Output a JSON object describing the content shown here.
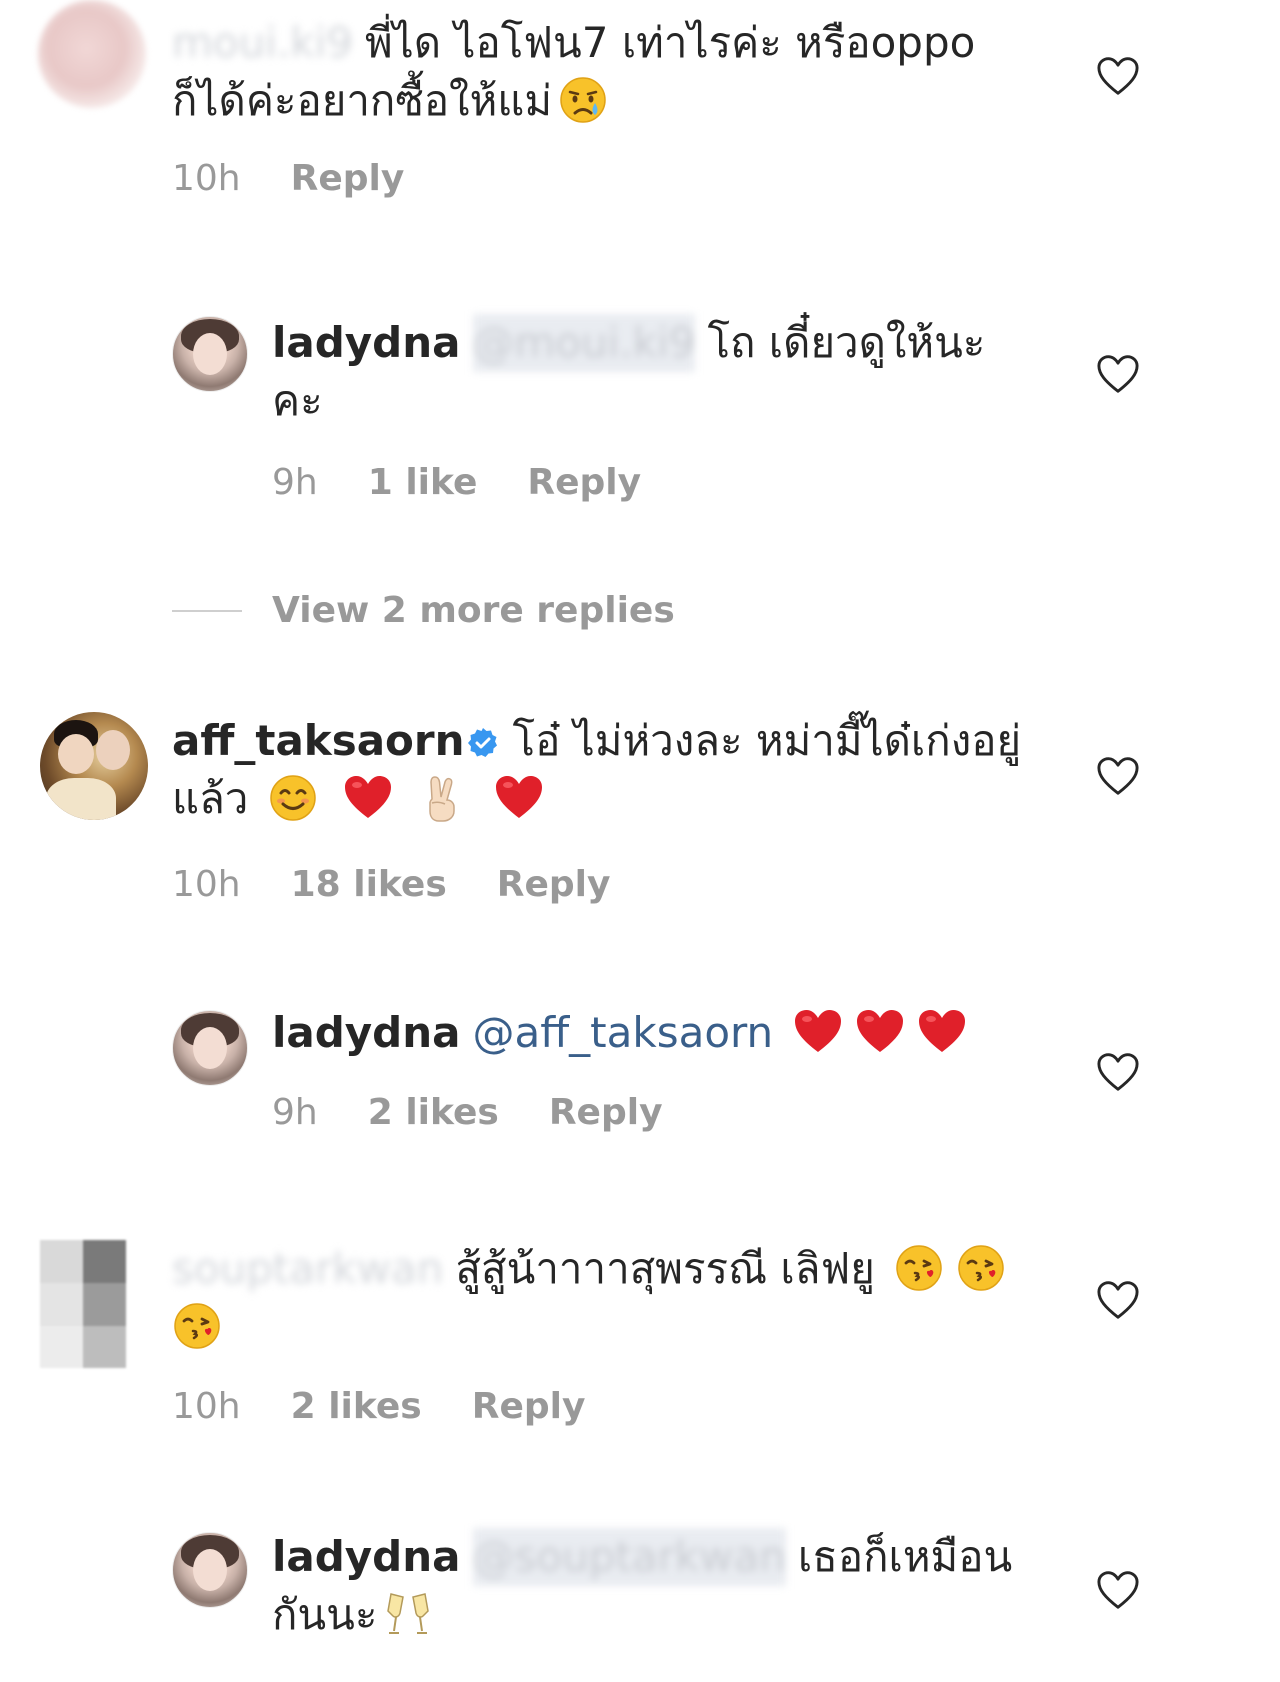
{
  "comments": [
    {
      "blurred_user": "moui.ki9",
      "text_line1": "พี่ได ไอโฟน7 เท่าไรค่ะ หรือoppo",
      "text_line2": "ก็ได้ค่ะอยากซื้อให้แม่",
      "emoji_end": "crying-face",
      "time": "10h",
      "reply": "Reply"
    },
    {
      "user": "ladydna",
      "blurred_mention": "@moui.ki9",
      "text_line1": "โถ เดี๋ยวดูให้นะ",
      "text_line2": "คะ",
      "time": "9h",
      "likes": "1 like",
      "reply": "Reply"
    },
    {
      "more_replies": "View 2 more replies"
    },
    {
      "user": "aff_taksaorn",
      "text_line1": "โอ๋ ไม่ห่วงละ หม่ามี๊ได๋เก่งอยู่",
      "text_line2": "แล้ว",
      "emojis": [
        "smiling-face",
        "red-heart",
        "victory-hand",
        "red-heart"
      ],
      "time": "10h",
      "likes": "18 likes",
      "reply": "Reply"
    },
    {
      "user": "ladydna",
      "mention": "@aff_taksaorn",
      "emojis": [
        "red-heart",
        "red-heart",
        "red-heart"
      ],
      "time": "9h",
      "likes": "2 likes",
      "reply": "Reply"
    },
    {
      "blurred_user": "souptarkwan",
      "text_line1": "สู้สู้น้าาาาสุพรรณี เลิฟยู",
      "emojis": [
        "kissing-face",
        "kissing-face",
        "kissing-face"
      ],
      "time": "10h",
      "likes": "2 likes",
      "reply": "Reply"
    },
    {
      "user": "ladydna",
      "blurred_mention": "@souptarkwan",
      "text_line1": "เธอก็เหมือน",
      "text_line2": "กันนะ",
      "emoji_end": "clinking-glasses"
    }
  ],
  "colors": {
    "text": "#262626",
    "meta": "#999999",
    "mention": "#3a5f8a",
    "verified": "#3897f0",
    "heart_red": "#e0202a"
  }
}
